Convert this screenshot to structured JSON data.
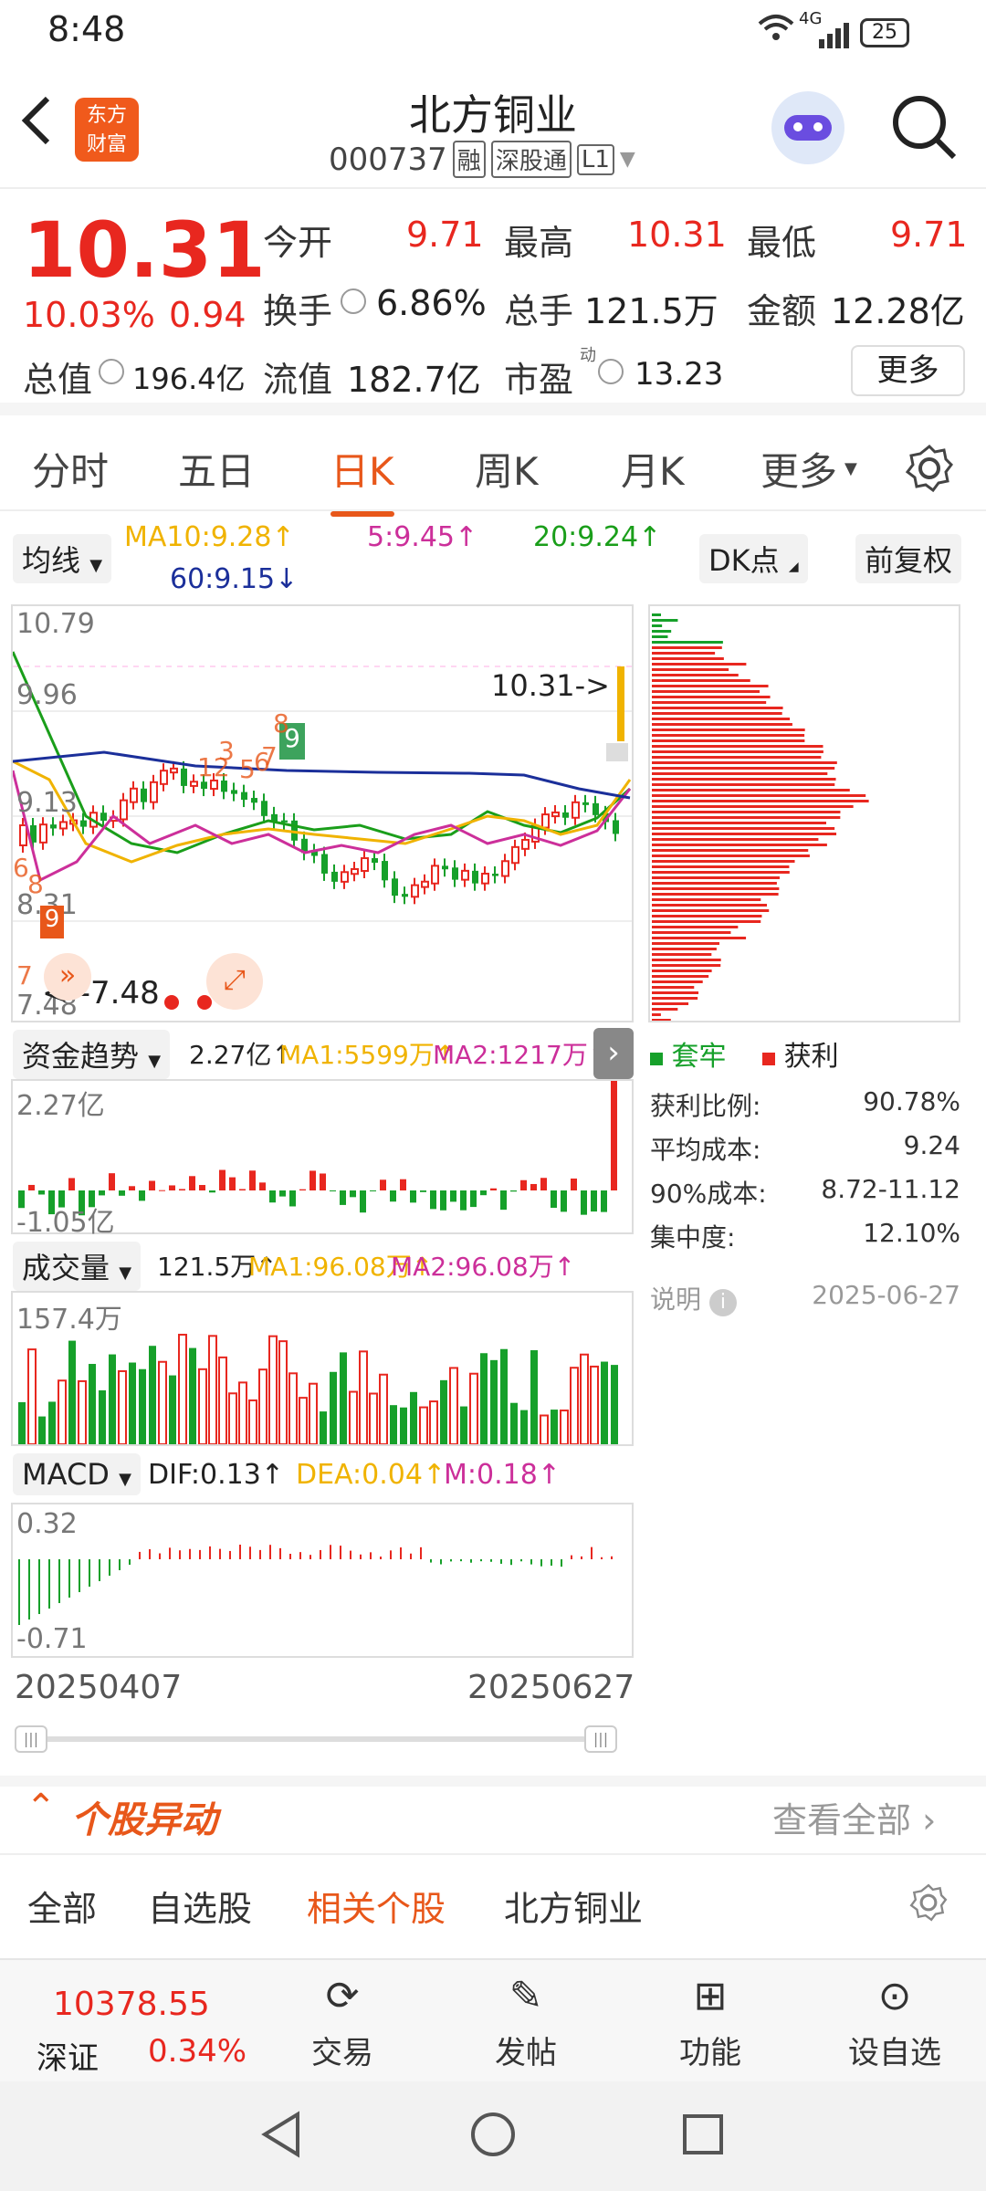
{
  "status": {
    "time": "8:48",
    "network": "4G",
    "battery": "25"
  },
  "header": {
    "title": "北方铜业",
    "code": "000737",
    "tags": [
      "融",
      "深股通",
      "L1"
    ],
    "logo": "东方\n财富"
  },
  "quote": {
    "price": "10.31",
    "pct": "10.03%",
    "chg": "0.94",
    "open_label": "今开",
    "open": "9.71",
    "high_label": "最高",
    "high": "10.31",
    "low_label": "最低",
    "low": "9.71",
    "turnover_label": "换手",
    "turnover": "6.86%",
    "volume_label": "总手",
    "volume": "121.5万",
    "amount_label": "金额",
    "amount": "12.28亿",
    "mktcap_label": "总值",
    "mktcap": "196.4亿",
    "float_label": "流值",
    "float": "182.7亿",
    "pe_label": "市盈",
    "pe_sup": "动",
    "pe": "13.23",
    "more": "更多"
  },
  "tabs": [
    "分时",
    "五日",
    "日K",
    "周K",
    "月K",
    "更多"
  ],
  "ma": {
    "selector": "均线",
    "ma10": "MA10:9.28↑",
    "ma5": "5:9.45↑",
    "ma20": "20:9.24↑",
    "ma60": "60:9.15↓",
    "dk": "DK点",
    "fq": "前复权"
  },
  "kline": {
    "y_top": "10.79",
    "y2": "9.96",
    "y3": "9.13",
    "y4": "8.31",
    "y_bottom": "7.48",
    "current": "10.31->",
    "low_marker": "<--7.48",
    "markers": [
      "9",
      "8",
      "3",
      "12",
      "5",
      "6",
      "7",
      "6",
      "8",
      "9",
      "7"
    ]
  },
  "chip": {
    "legend_loss": "套牢",
    "legend_profit": "获利",
    "rows": [
      {
        "label": "获利比例:",
        "value": "90.78%"
      },
      {
        "label": "平均成本:",
        "value": "9.24"
      },
      {
        "label": "90%成本:",
        "value": "8.72-11.12"
      },
      {
        "label": "集中度:",
        "value": "12.10%"
      }
    ],
    "note": "说明",
    "date": "2025-06-27"
  },
  "fund": {
    "selector": "资金趋势",
    "value": "2.27亿↑",
    "ma1": "MA1:5599万↑",
    "ma2": "MA2:1217万↑",
    "top": "2.27亿",
    "bottom": "-1.05亿"
  },
  "vol": {
    "selector": "成交量",
    "value": "121.5万↑",
    "ma1": "MA1:96.08万↑",
    "ma2": "MA2:96.08万↑",
    "top": "157.4万"
  },
  "macd": {
    "selector": "MACD",
    "dif": "DIF:0.13↑",
    "dea": "DEA:0.04↑",
    "m": "M:0.18↑",
    "top": "0.32",
    "bottom": "-0.71"
  },
  "dates": {
    "start": "20250407",
    "end": "20250627"
  },
  "movement": {
    "title": "个股异动",
    "view_all": "查看全部"
  },
  "filters": [
    "全部",
    "自选股",
    "相关个股",
    "北方铜业"
  ],
  "bottom": {
    "index_value": "10378.55",
    "index_name": "深证",
    "index_pct": "0.34%",
    "trade": "交易",
    "post": "发帖",
    "func": "功能",
    "watch": "设自选"
  },
  "colors": {
    "red": "#e8271f",
    "green": "#16a02a",
    "accent": "#e8571a"
  }
}
